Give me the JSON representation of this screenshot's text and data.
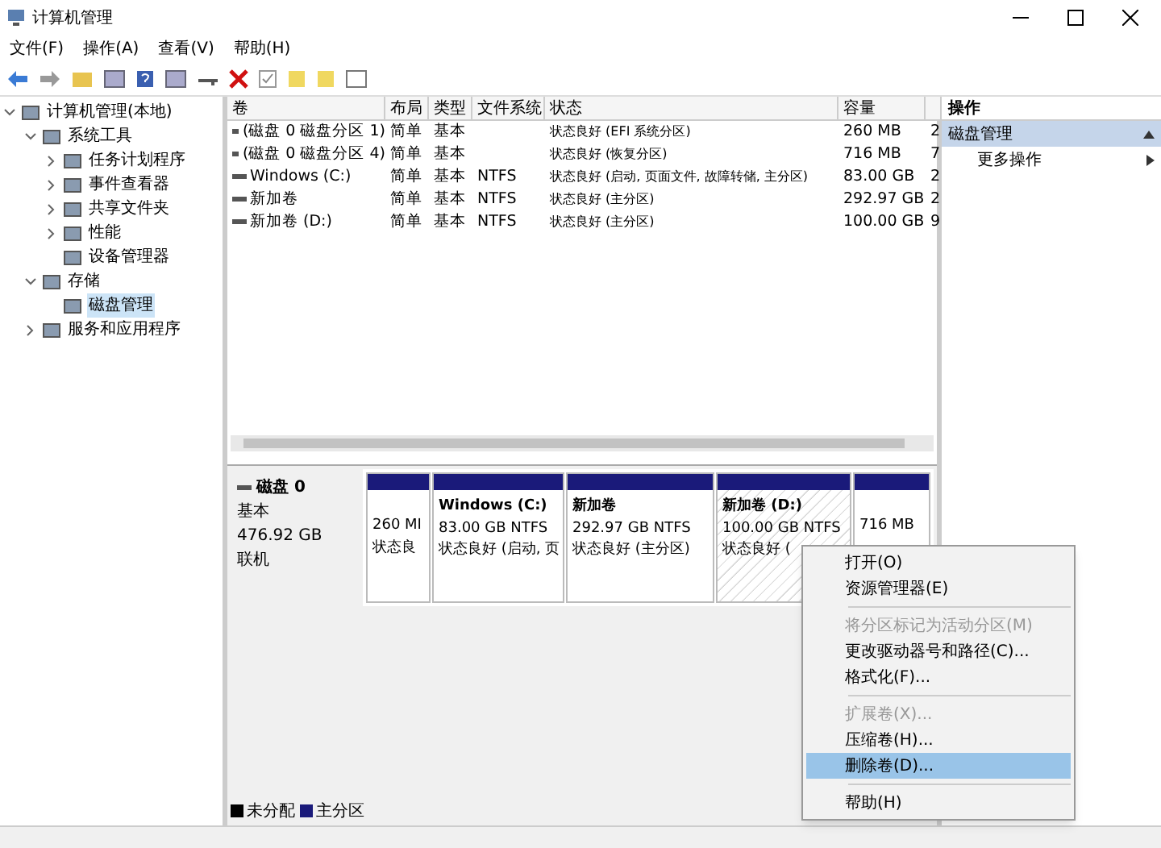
{
  "window": {
    "title": "计算机管理"
  },
  "menu": [
    "文件(F)",
    "操作(A)",
    "查看(V)",
    "帮助(H)"
  ],
  "tree": [
    {
      "label": "计算机管理(本地)",
      "expanded": true,
      "selected": false,
      "children": [
        {
          "label": "系统工具",
          "expanded": true,
          "selected": false,
          "children": [
            {
              "label": "任务计划程序",
              "expanded": false,
              "selected": false
            },
            {
              "label": "事件查看器",
              "expanded": false,
              "selected": false
            },
            {
              "label": "共享文件夹",
              "expanded": false,
              "selected": false
            },
            {
              "label": "性能",
              "expanded": false,
              "selected": false
            },
            {
              "label": "设备管理器",
              "selected": false
            }
          ]
        },
        {
          "label": "存储",
          "expanded": true,
          "selected": false,
          "children": [
            {
              "label": "磁盘管理",
              "selected": true
            }
          ]
        },
        {
          "label": "服务和应用程序",
          "expanded": false,
          "selected": false
        }
      ]
    }
  ],
  "table": {
    "columns": [
      "卷",
      "布局",
      "类型",
      "文件系统",
      "状态",
      "容量"
    ],
    "rows": [
      [
        "(磁盘 0 磁盘分区 1)",
        "简单",
        "基本",
        "",
        "状态良好 (EFI 系统分区)",
        "260 MB",
        "2"
      ],
      [
        "(磁盘 0 磁盘分区 4)",
        "简单",
        "基本",
        "",
        "状态良好 (恢复分区)",
        "716 MB",
        "7"
      ],
      [
        "Windows  (C:)",
        "简单",
        "基本",
        "NTFS",
        "状态良好 (启动, 页面文件, 故障转储, 主分区)",
        "83.00 GB",
        "2"
      ],
      [
        "新加卷",
        "简单",
        "基本",
        "NTFS",
        "状态良好 (主分区)",
        "292.97 GB",
        "2"
      ],
      [
        "新加卷 (D:)",
        "简单",
        "基本",
        "NTFS",
        "状态良好 (主分区)",
        "100.00 GB",
        "9"
      ]
    ]
  },
  "disk": {
    "name": "磁盘 0",
    "type": "基本",
    "size": "476.92 GB",
    "status": "联机",
    "partitions": [
      {
        "size": "260 MI",
        "status": "状态良",
        "selected": false
      },
      {
        "title": "Windows   (C:)",
        "size": "83.00 GB NTFS",
        "status": "状态良好 (启动, 页",
        "selected": false
      },
      {
        "title": "新加卷",
        "size": "292.97 GB NTFS",
        "status": "状态良好 (主分区)",
        "selected": false
      },
      {
        "title": "新加卷  (D:)",
        "size": "100.00 GB NTFS",
        "status": "状态良好 (",
        "selected": true
      },
      {
        "size": "716 MB",
        "selected": false
      }
    ]
  },
  "legend": [
    {
      "label": "未分配",
      "color": "#000000"
    },
    {
      "label": "主分区",
      "color": "#1a1a7a"
    }
  ],
  "actions": {
    "title": "操作",
    "section": "磁盘管理",
    "items": [
      "更多操作"
    ]
  },
  "context_menu": [
    {
      "kind": "item",
      "label": "打开(O)",
      "disabled": false,
      "selected": false
    },
    {
      "kind": "item",
      "label": "资源管理器(E)",
      "disabled": false,
      "selected": false
    },
    {
      "kind": "separator"
    },
    {
      "kind": "item",
      "label": "将分区标记为活动分区(M)",
      "disabled": true,
      "selected": false
    },
    {
      "kind": "item",
      "label": "更改驱动器号和路径(C)...",
      "disabled": false,
      "selected": false
    },
    {
      "kind": "item",
      "label": "格式化(F)...",
      "disabled": false,
      "selected": false
    },
    {
      "kind": "separator"
    },
    {
      "kind": "item",
      "label": "扩展卷(X)...",
      "disabled": true,
      "selected": false
    },
    {
      "kind": "item",
      "label": "压缩卷(H)...",
      "disabled": false,
      "selected": false
    },
    {
      "kind": "item",
      "label": "删除卷(D)...",
      "disabled": false,
      "selected": true
    },
    {
      "kind": "separator"
    },
    {
      "kind": "item",
      "label": "帮助(H)",
      "disabled": false,
      "selected": false
    }
  ]
}
